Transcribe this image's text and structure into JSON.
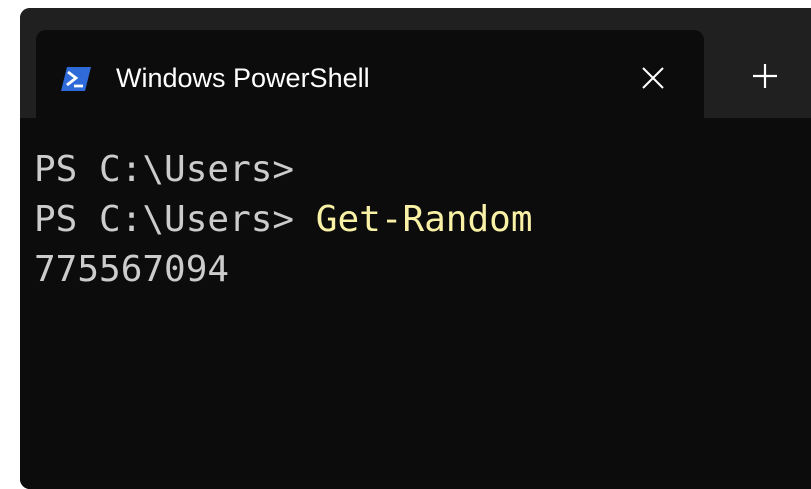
{
  "window": {
    "title": "Windows PowerShell",
    "icon": "powershell-icon",
    "close_icon": "close-icon",
    "new_tab_icon": "plus-icon"
  },
  "colors": {
    "background": "#0c0c0c",
    "titlebar": "#202020",
    "text": "#cccccc",
    "command": "#f9f1a5",
    "icon_blue": "#2e6ad8"
  },
  "terminal": {
    "lines": [
      {
        "prompt": "PS C:\\Users>",
        "command": ""
      },
      {
        "prompt": "PS C:\\Users> ",
        "command": "Get-Random"
      },
      {
        "output": "775567094"
      }
    ]
  }
}
